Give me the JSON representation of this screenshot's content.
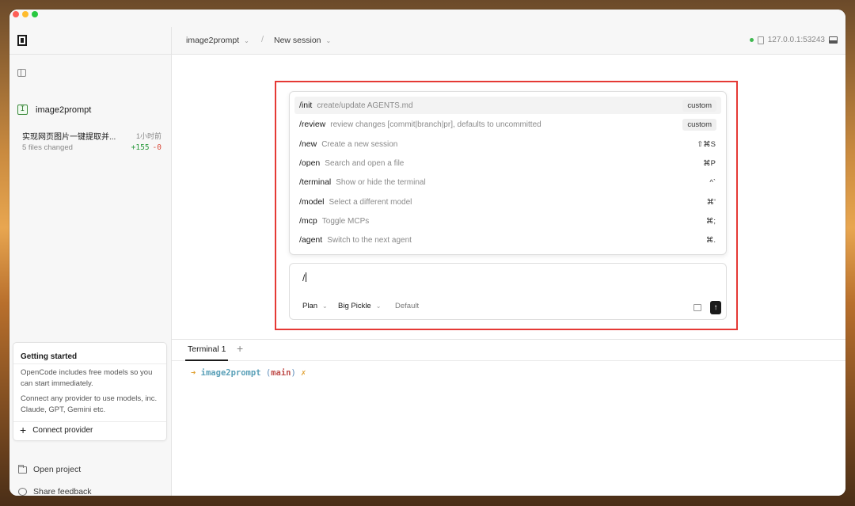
{
  "project": {
    "name": "image2prompt",
    "icon": "git-branch-icon"
  },
  "session": {
    "title": "实现网页图片一键提取并...",
    "time": "1小时前",
    "files_changed": "5 files changed",
    "additions": "+155",
    "deletions": "-0"
  },
  "getting_started": {
    "title": "Getting started",
    "text1": "OpenCode includes free models so you can start immediately.",
    "text2": "Connect any provider to use models, inc. Claude, GPT, Gemini etc.",
    "connect_label": "Connect provider"
  },
  "sidebar_footer": {
    "open_project": "Open project",
    "share_feedback": "Share feedback"
  },
  "breadcrumb": {
    "project": "image2prompt",
    "separator": "/",
    "session": "New session"
  },
  "server": {
    "address": "127.0.0.1:53243",
    "status_color": "#3fb950"
  },
  "commands": [
    {
      "name": "/init",
      "desc": "create/update AGENTS.md",
      "key": "custom"
    },
    {
      "name": "/review",
      "desc": "review changes [commit|branch|pr], defaults to uncommitted",
      "key": "custom"
    },
    {
      "name": "/new",
      "desc": "Create a new session",
      "key": "⇧⌘S"
    },
    {
      "name": "/open",
      "desc": "Search and open a file",
      "key": "⌘P"
    },
    {
      "name": "/terminal",
      "desc": "Show or hide the terminal",
      "key": "^`"
    },
    {
      "name": "/model",
      "desc": "Select a different model",
      "key": "⌘'"
    },
    {
      "name": "/mcp",
      "desc": "Toggle MCPs",
      "key": "⌘;"
    },
    {
      "name": "/agent",
      "desc": "Switch to the next agent",
      "key": "⌘."
    }
  ],
  "prompt": {
    "value": "/",
    "mode": "Plan",
    "model": "Big Pickle",
    "variant": "Default"
  },
  "terminal": {
    "tab_label": "Terminal 1",
    "prompt_arrow": "➜",
    "dir": "image2prompt",
    "branch_open": "(",
    "branch": "main",
    "branch_close": ")",
    "dirty": "✗"
  }
}
